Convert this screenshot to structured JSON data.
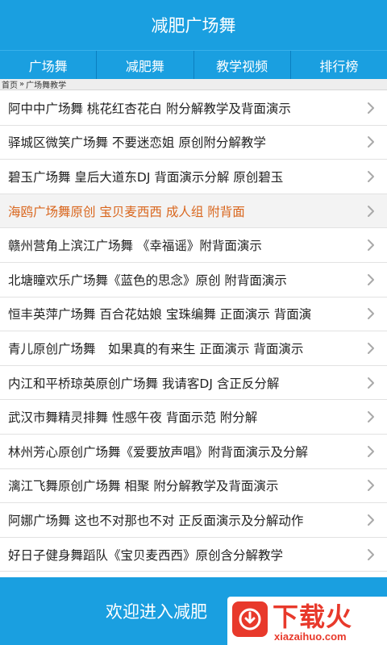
{
  "header": {
    "title": "减肥广场舞"
  },
  "tabs": [
    {
      "label": "广场舞"
    },
    {
      "label": "减肥舞"
    },
    {
      "label": "教学视频"
    },
    {
      "label": "排行榜"
    }
  ],
  "breadcrumb": {
    "home": "首页",
    "sep": "»",
    "current": "广场舞教学"
  },
  "list": [
    {
      "title": "阿中中广场舞 桃花红杏花白 附分解教学及背面演示"
    },
    {
      "title": "驿城区微笑广场舞 不要迷恋姐 原创附分解教学"
    },
    {
      "title": "碧玉广场舞 皇后大道东DJ 背面演示分解 原创碧玉"
    },
    {
      "title": "海鸥广场舞原创 宝贝麦西西 成人组 附背面",
      "highlight": true
    },
    {
      "title": "赣州营角上滨江广场舞 《幸福谣》附背面演示"
    },
    {
      "title": "北塘瞳欢乐广场舞《蓝色的思念》原创 附背面演示"
    },
    {
      "title": "恒丰英萍广场舞 百合花姑娘 宝珠编舞 正面演示 背面演"
    },
    {
      "title": "青儿原创广场舞　如果真的有来生 正面演示 背面演示"
    },
    {
      "title": "内江和平桥琼英原创广场舞 我请客DJ 含正反分解"
    },
    {
      "title": "武汉市舞精灵排舞 性感午夜 背面示范 附分解"
    },
    {
      "title": "林州芳心原创广场舞《爱要放声唱》附背面演示及分解"
    },
    {
      "title": "漓江飞舞原创广场舞 相聚 附分解教学及背面演示"
    },
    {
      "title": "阿娜广场舞 这也不对那也不对 正反面演示及分解动作"
    },
    {
      "title": "好日子健身舞蹈队《宝贝麦西西》原创含分解教学"
    }
  ],
  "footer": {
    "text": "欢迎进入减肥"
  },
  "watermark": {
    "title": "下载火",
    "url": "xiazaihuo.com"
  },
  "icons": {
    "chevron": "chevron-right-icon",
    "download": "download-icon"
  },
  "colors": {
    "primary": "#1a9fe0",
    "highlight_text": "#d9661d",
    "watermark": "#e8392b"
  }
}
